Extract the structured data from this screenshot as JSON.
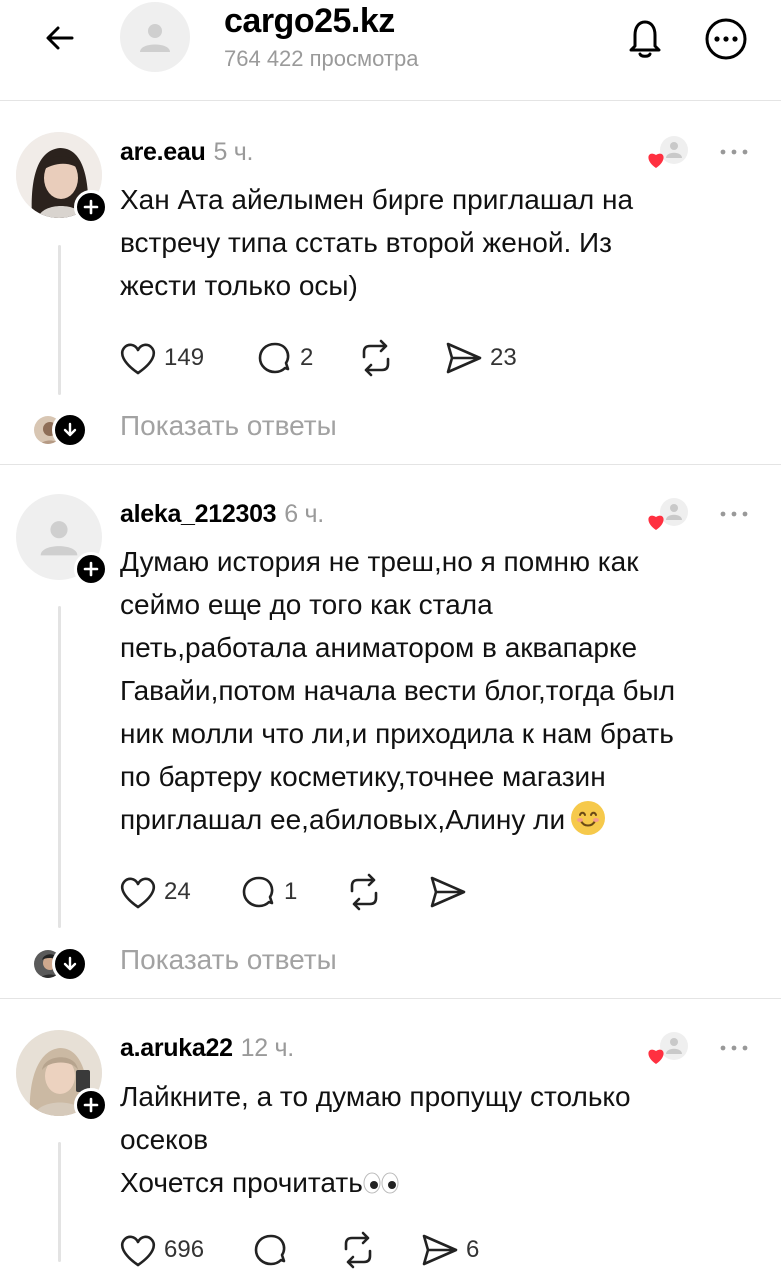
{
  "header": {
    "title": "cargo25.kz",
    "views": "764 422 просмотра",
    "back_icon": "arrow-left-icon",
    "bell_icon": "bell-icon",
    "more_icon": "more-circle-icon"
  },
  "comments": [
    {
      "username": "are.eau",
      "time": "5 ч.",
      "text": "Хан Ата айелымен бирге приглашал на\nвстречу типа сстать второй женой. Из\nжести только осы)",
      "likes": "149",
      "replies": "2",
      "reposts": "",
      "shares": "23",
      "show_replies": "Показать ответы"
    },
    {
      "username": "aleka_212303",
      "time": "6 ч.",
      "text": "Думаю история не треш,но я помню как\nсеймо еще до того как стала\nпеть,работала аниматором в аквапарке\nГавайи,потом начала вести блог,тогда был\nник молли что ли,и приходила к нам брать\nпо бартеру косметику,точнее магазин\nприглашал ее,абиловых,Алину ли",
      "likes": "24",
      "replies": "1",
      "reposts": "",
      "shares": "",
      "show_replies": "Показать ответы"
    },
    {
      "username": "a.aruka22",
      "time": "12 ч.",
      "text": "Лайкните, а то думаю пропущу столько\nосеков\nХочется прочитать",
      "likes": "696",
      "replies": "",
      "reposts": "",
      "shares": "6"
    }
  ],
  "colors": {
    "heart": "#ff3040",
    "muted": "#9a9a9a",
    "divider": "#e4e4e4"
  }
}
